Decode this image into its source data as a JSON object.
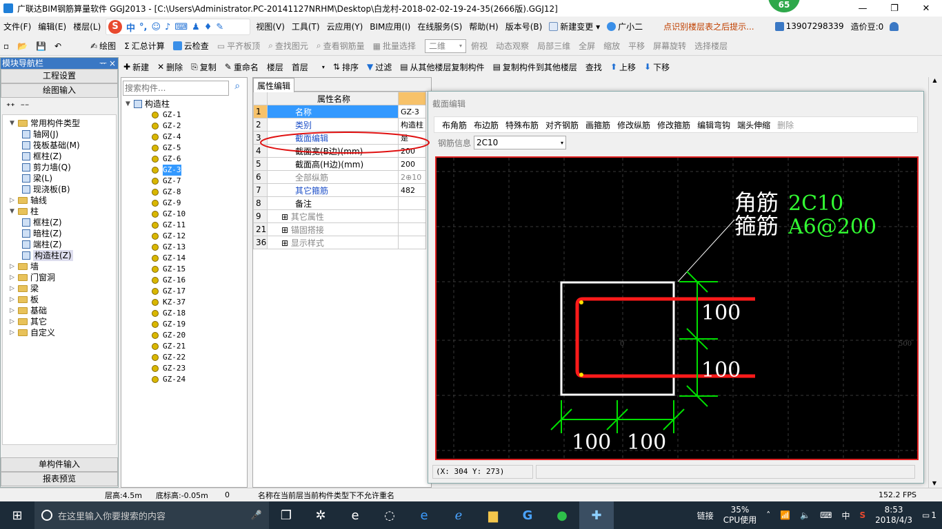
{
  "window": {
    "title": "广联达BIM钢筋算量软件 GGJ2013 - [C:\\Users\\Administrator.PC-20141127NRHM\\Desktop\\白龙村-2018-02-02-19-24-35(2666版).GGJ12]",
    "badge": "65",
    "minimize": "—",
    "restore": "❐",
    "close": "✕"
  },
  "menu": {
    "items": [
      "文件(F)",
      "编辑(E)",
      "楼层(L)"
    ],
    "items2": [
      "视图(V)",
      "工具(T)",
      "云应用(Y)",
      "BIM应用(I)",
      "在线服务(S)",
      "帮助(H)",
      "版本号(B)"
    ],
    "new_change": "新建变更 ▾",
    "assistant": "广小二",
    "tip": "点识别楼层表之后提示...",
    "phone": "13907298339",
    "cost_beans": "造价豆:0"
  },
  "sogou": {
    "logo": "S",
    "zh": "中",
    "punct": "°,"
  },
  "toolbar1": {
    "draw": "绘图",
    "sum": "汇总计算",
    "cloud_check": "云检查",
    "flat_top": "平齐板顶",
    "find_elem": "查找图元",
    "view_rebar": "查看钢筋量",
    "batch_select": "批量选择",
    "view_mode": "二维",
    "top_view": "俯视",
    "dynamic_view": "动态观察",
    "local_3d": "局部三维",
    "fullscreen": "全屏",
    "zoom": "缩放",
    "pan": "平移",
    "rotate": "屏幕旋转",
    "select_floor": "选择楼层"
  },
  "nav": {
    "title": "模块导航栏",
    "pin": "ᅲ",
    "close": "×",
    "project_settings": "工程设置",
    "drawing_input": "绘图输入",
    "single_input": "单构件输入",
    "report_preview": "报表预览",
    "tree": [
      {
        "label": "常用构件类型",
        "level": 0,
        "kind": "folder",
        "open": true
      },
      {
        "label": "轴网(J)",
        "level": 1,
        "kind": "item"
      },
      {
        "label": "筏板基础(M)",
        "level": 1,
        "kind": "item"
      },
      {
        "label": "框柱(Z)",
        "level": 1,
        "kind": "item"
      },
      {
        "label": "剪力墙(Q)",
        "level": 1,
        "kind": "item"
      },
      {
        "label": "梁(L)",
        "level": 1,
        "kind": "item"
      },
      {
        "label": "现浇板(B)",
        "level": 1,
        "kind": "item"
      },
      {
        "label": "轴线",
        "level": 0,
        "kind": "folder"
      },
      {
        "label": "柱",
        "level": 0,
        "kind": "folder",
        "open": true
      },
      {
        "label": "框柱(Z)",
        "level": 1,
        "kind": "item"
      },
      {
        "label": "暗柱(Z)",
        "level": 1,
        "kind": "item"
      },
      {
        "label": "端柱(Z)",
        "level": 1,
        "kind": "item"
      },
      {
        "label": "构造柱(Z)",
        "level": 1,
        "kind": "item",
        "selected": true
      },
      {
        "label": "墙",
        "level": 0,
        "kind": "folder"
      },
      {
        "label": "门窗洞",
        "level": 0,
        "kind": "folder"
      },
      {
        "label": "梁",
        "level": 0,
        "kind": "folder"
      },
      {
        "label": "板",
        "level": 0,
        "kind": "folder"
      },
      {
        "label": "基础",
        "level": 0,
        "kind": "folder"
      },
      {
        "label": "其它",
        "level": 0,
        "kind": "folder"
      },
      {
        "label": "自定义",
        "level": 0,
        "kind": "folder"
      }
    ]
  },
  "toolbar2": {
    "new": "新建",
    "delete": "删除",
    "copy": "复制",
    "rename": "重命名",
    "floor_label": "楼层",
    "floor_value": "首层",
    "sort": "排序",
    "filter": "过滤",
    "copy_from": "从其他楼层复制构件",
    "copy_to": "复制构件到其他楼层",
    "find": "查找",
    "move_up": "上移",
    "move_down": "下移"
  },
  "component_list": {
    "search_placeholder": "搜索构件...",
    "root": "构造柱",
    "items": [
      "GZ-1",
      "GZ-2",
      "GZ-4",
      "GZ-5",
      "GZ-6",
      "GZ-3",
      "GZ-7",
      "GZ-8",
      "GZ-9",
      "GZ-10",
      "GZ-11",
      "GZ-12",
      "GZ-13",
      "GZ-14",
      "GZ-15",
      "GZ-16",
      "GZ-17",
      "KZ-37",
      "GZ-18",
      "GZ-19",
      "GZ-20",
      "GZ-21",
      "GZ-22",
      "GZ-23",
      "GZ-24"
    ],
    "selected_index": 5
  },
  "properties": {
    "tab": "属性编辑",
    "header": "属性名称",
    "rows": [
      {
        "num": "1",
        "name": "名称",
        "value": "GZ-3"
      },
      {
        "num": "2",
        "name": "类别",
        "value": "构造柱"
      },
      {
        "num": "3",
        "name": "截面编辑",
        "value": "是"
      },
      {
        "num": "4",
        "name": "截面宽(B边)(mm)",
        "value": "200"
      },
      {
        "num": "5",
        "name": "截面高(H边)(mm)",
        "value": "200"
      },
      {
        "num": "6",
        "name": "全部纵筋",
        "value": "2⊕10"
      },
      {
        "num": "7",
        "name": "其它箍筋",
        "value": "482"
      },
      {
        "num": "8",
        "name": "备注",
        "value": ""
      },
      {
        "num": "9",
        "name": "其它属性",
        "value": ""
      },
      {
        "num": "21",
        "name": "锚固搭接",
        "value": ""
      },
      {
        "num": "36",
        "name": "显示样式",
        "value": ""
      }
    ]
  },
  "section_editor": {
    "title": "截面编辑",
    "buttons": [
      "布角筋",
      "布边筋",
      "特殊布筋",
      "对齐钢筋",
      "画箍筋",
      "修改纵筋",
      "修改箍筋",
      "编辑弯钩",
      "端头伸缩",
      "删除"
    ],
    "rebar_info_label": "钢筋信息",
    "rebar_info_value": "2C10",
    "corner_label": "角筋",
    "corner_value": "2C10",
    "stirrup_label": "箍筋",
    "stirrup_value": "A6@200",
    "dim_right_top": "100",
    "dim_right_bottom": "100",
    "dim_bottom_left": "100",
    "dim_bottom_right": "100",
    "axis_origin": "0",
    "axis_right": "500",
    "coords": "(X: 304 Y: 273)"
  },
  "statusbar": {
    "floor_height": "层高:4.5m",
    "base_height": "底标高:-0.05m",
    "zero": "0",
    "message": "名称在当前层当前构件类型下不允许重名",
    "fps": "152.2 FPS"
  },
  "taskbar": {
    "search_placeholder": "在这里输入你要搜索的内容",
    "link": "链接",
    "cpu": "35%",
    "cpu_label": "CPU使用",
    "ime": "中",
    "time": "8:53",
    "date": "2018/4/3",
    "notify": "1"
  },
  "colors": {
    "accent": "#3a78c4",
    "selected": "#3399ff",
    "rebar_red": "#ff1a1a",
    "dim_green": "#00e000"
  }
}
